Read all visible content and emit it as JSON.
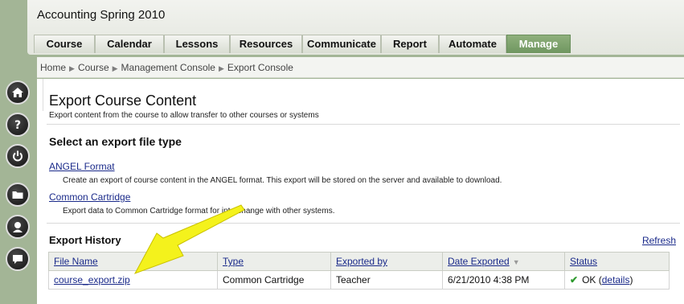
{
  "app": {
    "title": "Accounting Spring 2010"
  },
  "tabs": [
    "Course",
    "Calendar",
    "Lessons",
    "Resources",
    "Communicate",
    "Report",
    "Automate",
    "Manage"
  ],
  "active_tab": "Manage",
  "breadcrumb": [
    "Home",
    "Course",
    "Management Console",
    "Export Console"
  ],
  "left_rail": [
    "home-icon",
    "help-icon",
    "power-icon",
    "folder-icon",
    "user-icon",
    "chat-icon"
  ],
  "page": {
    "title": "Export Course Content",
    "subtitle": "Export content from the course to allow transfer to other courses or systems",
    "section_title": "Select an export file type",
    "options": [
      {
        "label": "ANGEL Format",
        "description": "Create an export of course content in the ANGEL format. This export will be stored on the server and available to download."
      },
      {
        "label": "Common Cartridge",
        "description": "Export data to Common Cartridge format for interchange with other systems."
      }
    ],
    "history_title": "Export History",
    "refresh_label": "Refresh"
  },
  "history": {
    "columns": [
      "File Name",
      "Type",
      "Exported by",
      "Date Exported",
      "Status"
    ],
    "rows": [
      {
        "file_name": "course_export.zip",
        "type": "Common Cartridge",
        "exported_by": "Teacher",
        "date": "6/21/2010 4:38 PM",
        "status": "OK",
        "details_label": "details"
      }
    ]
  },
  "colors": {
    "accent_green": "#7ea46a",
    "link_blue": "#1a2a8a",
    "arrow_yellow": "#f4f21c"
  }
}
